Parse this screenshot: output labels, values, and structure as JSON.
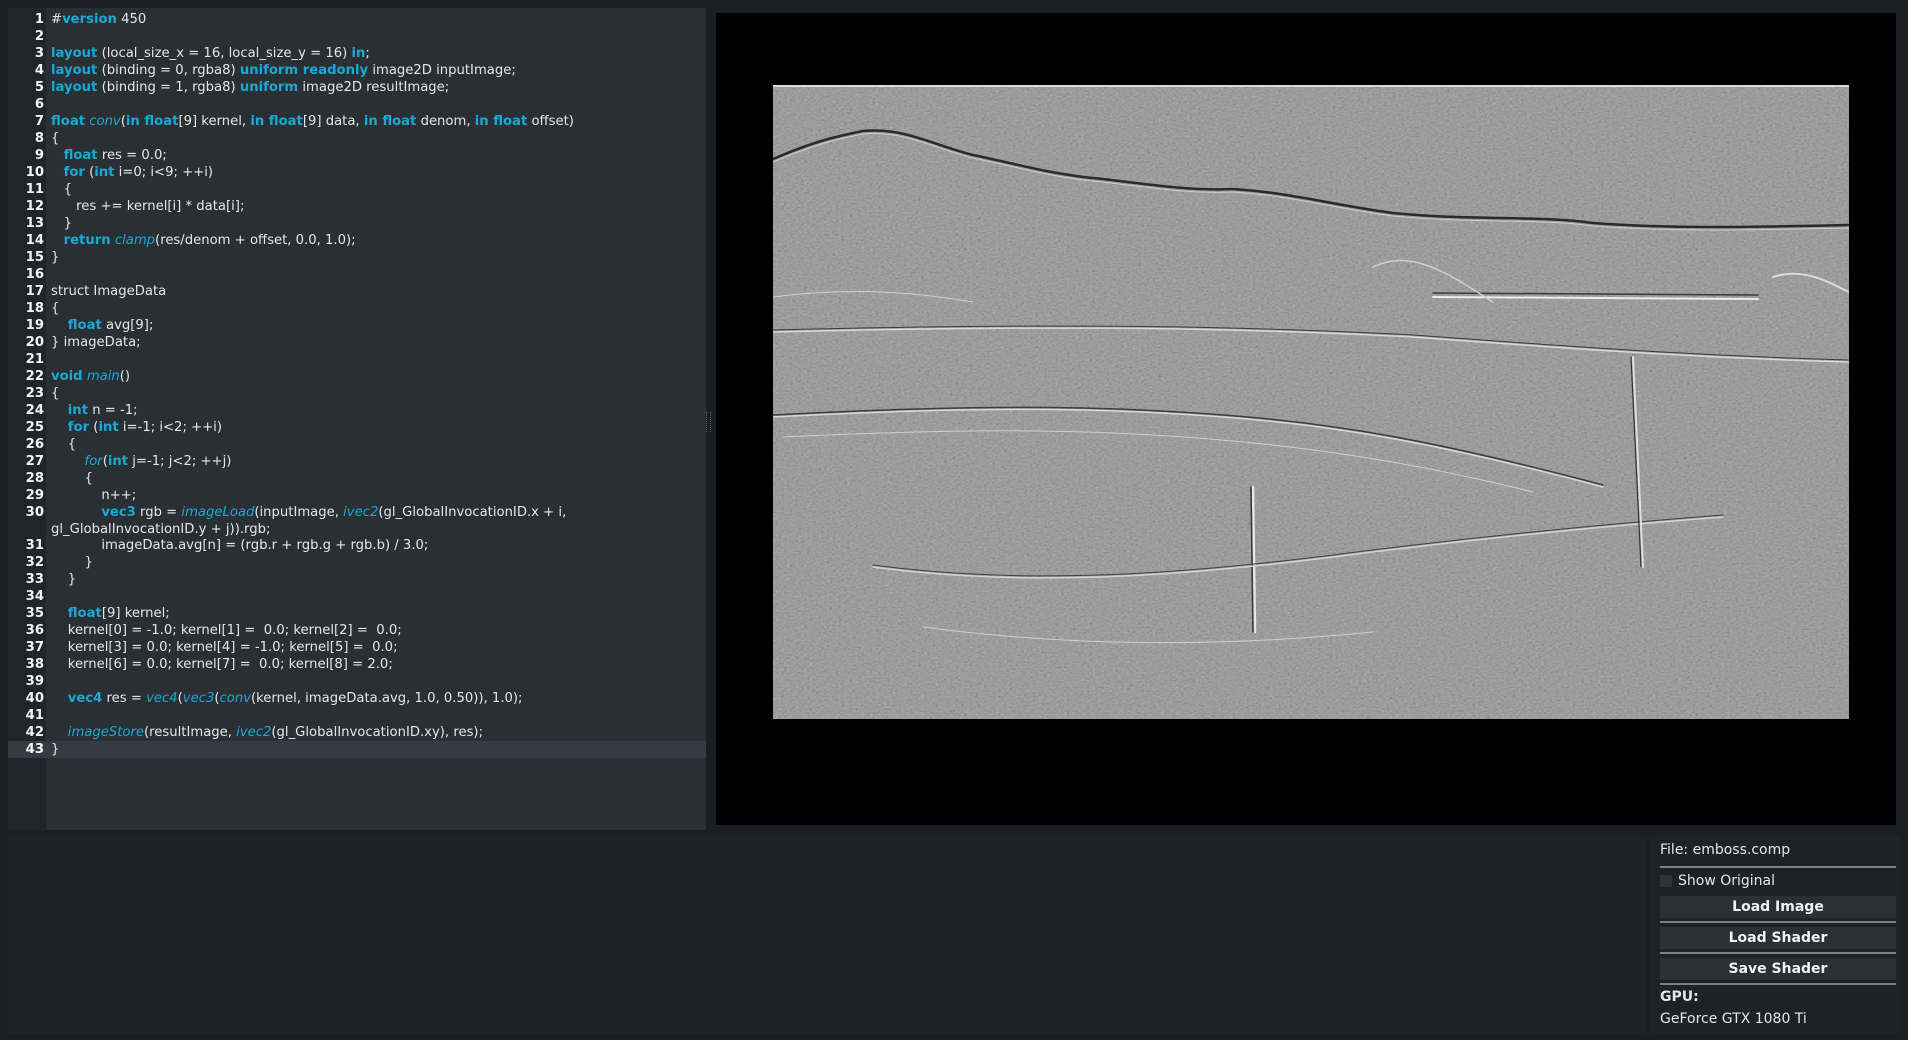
{
  "editor": {
    "lines": [
      {
        "n": "1",
        "h": "#<span class=\"kw\">version</span> 450"
      },
      {
        "n": "2",
        "h": ""
      },
      {
        "n": "3",
        "h": "<span class=\"kw\">layout</span> (local_size_x = 16, local_size_y = 16) <span class=\"kw\">in</span>;"
      },
      {
        "n": "4",
        "h": "<span class=\"kw\">layout</span> (binding = 0, rgba8) <span class=\"kw\">uniform readonly</span> image2D inputImage;"
      },
      {
        "n": "5",
        "h": "<span class=\"kw\">layout</span> (binding = 1, rgba8) <span class=\"kw\">uniform</span> image2D resultImage;"
      },
      {
        "n": "6",
        "h": ""
      },
      {
        "n": "7",
        "h": "<span class=\"kw\">float</span> <span class=\"fn\">conv</span>(<span class=\"kw\">in float</span>[9] kernel, <span class=\"kw\">in float</span>[9] data, <span class=\"kw\">in float</span> denom, <span class=\"kw\">in float</span> offset)"
      },
      {
        "n": "8",
        "h": "{"
      },
      {
        "n": "9",
        "h": "   <span class=\"kw\">float</span> res = 0.0;"
      },
      {
        "n": "10",
        "h": "   <span class=\"kw\">for</span> (<span class=\"kw\">int</span> i=0; i&lt;9; ++i)"
      },
      {
        "n": "11",
        "h": "   {"
      },
      {
        "n": "12",
        "h": "      res += kernel[i] * data[i];"
      },
      {
        "n": "13",
        "h": "   }"
      },
      {
        "n": "14",
        "h": "   <span class=\"kw\">return</span> <span class=\"fn\">clamp</span>(res/denom + offset, 0.0, 1.0);"
      },
      {
        "n": "15",
        "h": "}"
      },
      {
        "n": "16",
        "h": ""
      },
      {
        "n": "17",
        "h": "struct ImageData"
      },
      {
        "n": "18",
        "h": "{"
      },
      {
        "n": "19",
        "h": "    <span class=\"kw\">float</span> avg[9];"
      },
      {
        "n": "20",
        "h": "} imageData;"
      },
      {
        "n": "21",
        "h": ""
      },
      {
        "n": "22",
        "h": "<span class=\"kw\">void</span> <span class=\"fn\">main</span>()"
      },
      {
        "n": "23",
        "h": "{"
      },
      {
        "n": "24",
        "h": "    <span class=\"kw\">int</span> n = -1;"
      },
      {
        "n": "25",
        "h": "    <span class=\"kw\">for</span> (<span class=\"kw\">int</span> i=-1; i&lt;2; ++i)"
      },
      {
        "n": "26",
        "h": "    {"
      },
      {
        "n": "27",
        "h": "        <span class=\"fn\">for</span>(<span class=\"kw\">int</span> j=-1; j&lt;2; ++j)"
      },
      {
        "n": "28",
        "h": "        {"
      },
      {
        "n": "29",
        "h": "            n++;"
      },
      {
        "n": "30",
        "h": "            <span class=\"kw\">vec3</span> rgb = <span class=\"fn\">imageLoad</span>(inputImage, <span class=\"fn\">ivec2</span>(gl_GlobalInvocationID.x + i, gl_GlobalInvocationID.y + j)).rgb;",
        "wrap": true
      },
      {
        "n": "31",
        "h": "            imageData.avg[n] = (rgb.r + rgb.g + rgb.b) / 3.0;"
      },
      {
        "n": "32",
        "h": "        }"
      },
      {
        "n": "33",
        "h": "    }"
      },
      {
        "n": "34",
        "h": ""
      },
      {
        "n": "35",
        "h": "    <span class=\"kw\">float</span>[9] kernel;"
      },
      {
        "n": "36",
        "h": "    kernel[0] = -1.0; kernel[1] =  0.0; kernel[2] =  0.0;"
      },
      {
        "n": "37",
        "h": "    kernel[3] = 0.0; kernel[4] = -1.0; kernel[5] =  0.0;"
      },
      {
        "n": "38",
        "h": "    kernel[6] = 0.0; kernel[7] =  0.0; kernel[8] = 2.0;"
      },
      {
        "n": "39",
        "h": ""
      },
      {
        "n": "40",
        "h": "    <span class=\"kw\">vec4</span> res = <span class=\"fn\">vec4</span>(<span class=\"fn\">vec3</span>(<span class=\"fn\">conv</span>(kernel, imageData.avg, 1.0, 0.50)), 1.0);"
      },
      {
        "n": "41",
        "h": ""
      },
      {
        "n": "42",
        "h": "    <span class=\"fn\">imageStore</span>(resultImage, <span class=\"fn\">ivec2</span>(gl_GlobalInvocationID.xy), res);"
      },
      {
        "n": "43",
        "h": "}",
        "current": true
      }
    ]
  },
  "panel": {
    "file_label": "File: emboss.comp",
    "show_original_label": "Show Original",
    "show_original_checked": false,
    "load_image_label": "Load Image",
    "load_shader_label": "Load Shader",
    "save_shader_label": "Save Shader",
    "gpu_heading": "GPU:",
    "gpu_name": "GeForce GTX 1080 Ti"
  },
  "colors": {
    "keyword": "#19a9d6",
    "background": "#1b1f24",
    "editor_bg": "#2a2f34"
  }
}
